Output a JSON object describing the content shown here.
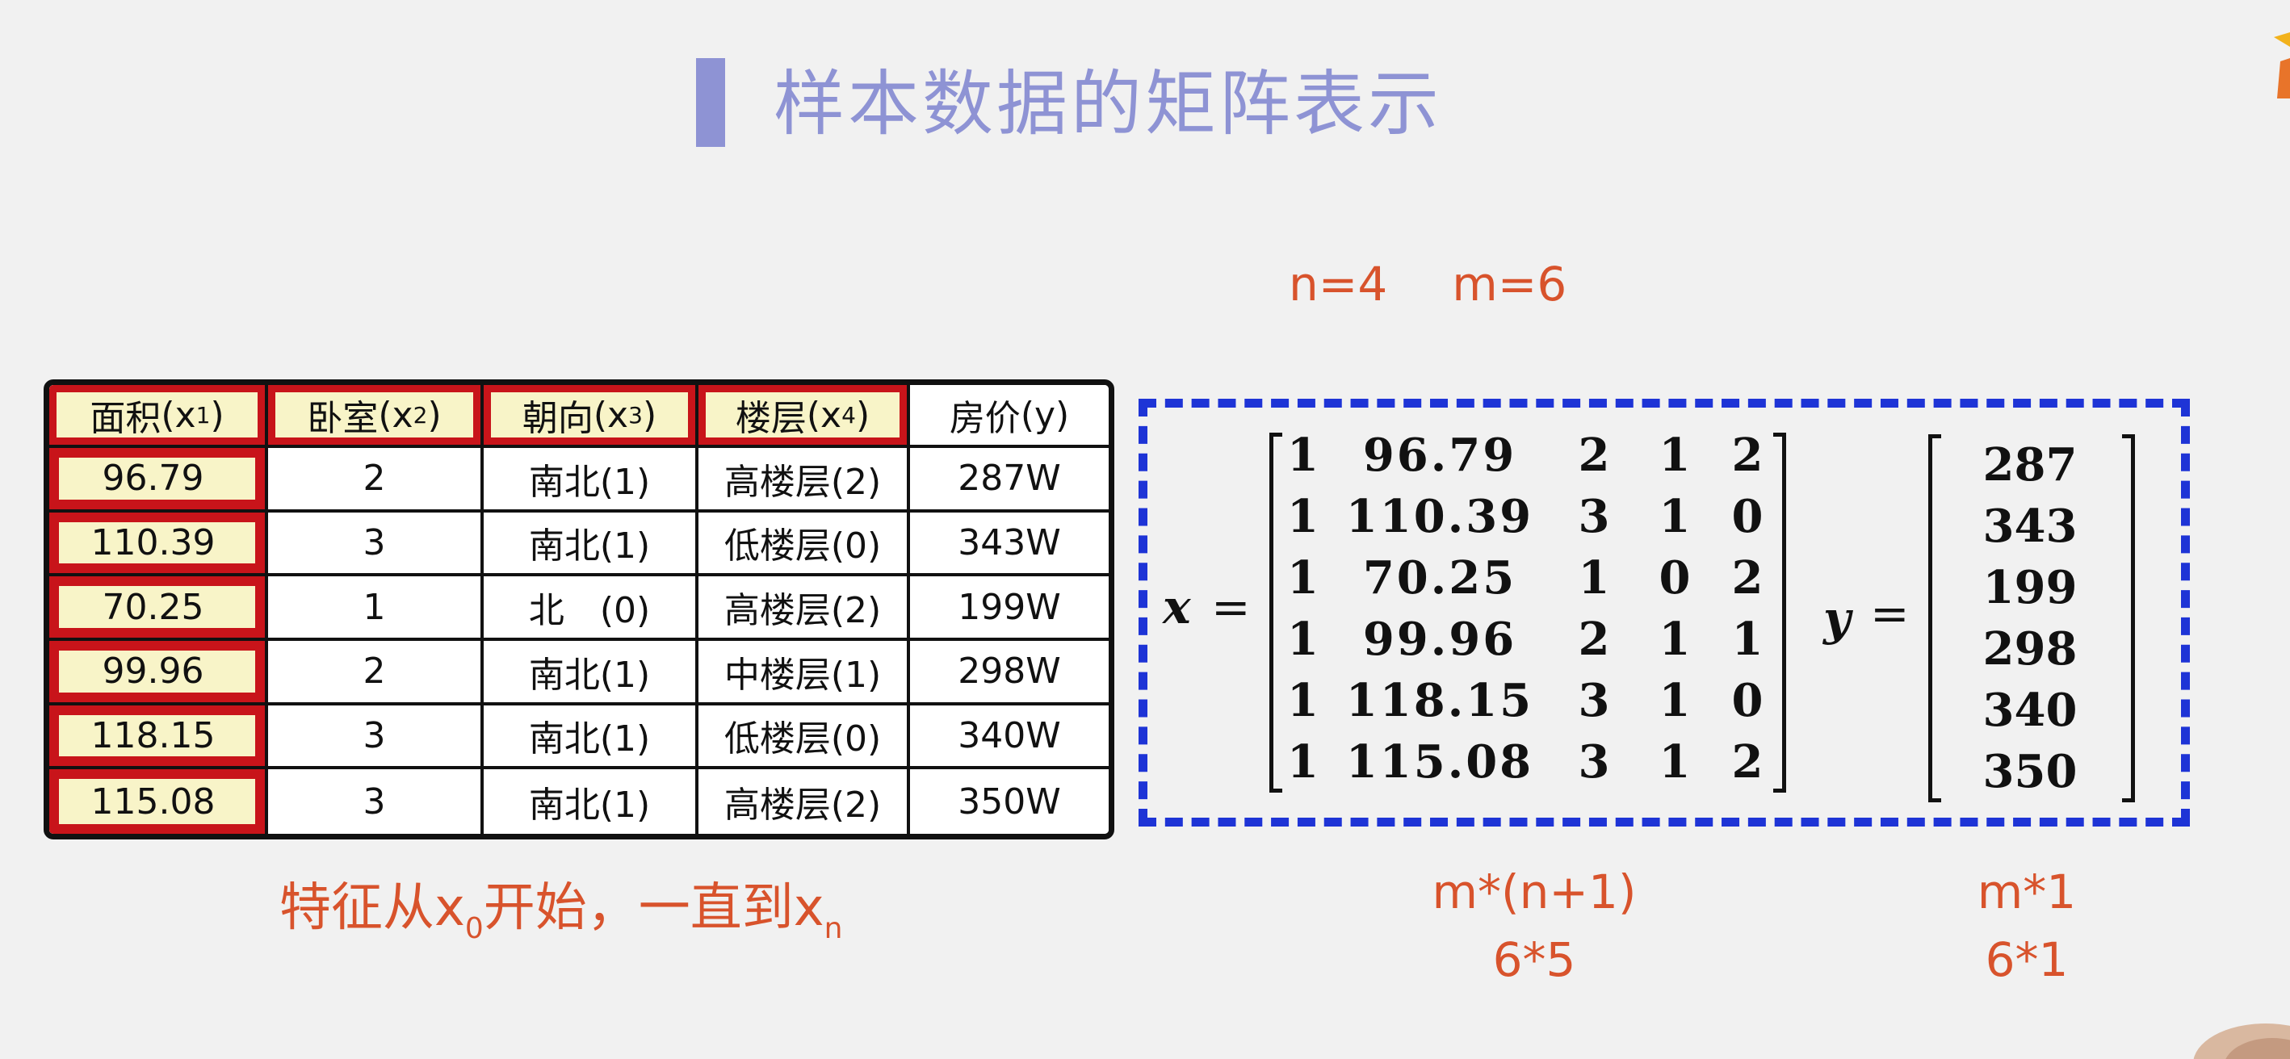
{
  "title": "样本数据的矩阵表示",
  "params": {
    "n": "n=4",
    "m": "m=6"
  },
  "table": {
    "headers": [
      {
        "label": "面积",
        "var": "(x",
        "sub": "1",
        "close": ")"
      },
      {
        "label": "卧室",
        "var": "(x",
        "sub": "2",
        "close": ")"
      },
      {
        "label": "朝向",
        "var": "(x",
        "sub": "3",
        "close": ")"
      },
      {
        "label": "楼层",
        "var": "(x",
        "sub": "4",
        "close": ")"
      },
      {
        "label": "房价",
        "var": "(y)",
        "sub": "",
        "close": ""
      }
    ],
    "rows": [
      [
        "96.79",
        "2",
        "南北(1)",
        "高楼层(2)",
        "287W"
      ],
      [
        "110.39",
        "3",
        "南北(1)",
        "低楼层(0)",
        "343W"
      ],
      [
        "70.25",
        "1",
        "北　(0)",
        "高楼层(2)",
        "199W"
      ],
      [
        "99.96",
        "2",
        "南北(1)",
        "中楼层(1)",
        "298W"
      ],
      [
        "118.15",
        "3",
        "南北(1)",
        "低楼层(0)",
        "340W"
      ],
      [
        "115.08",
        "3",
        "南北(1)",
        "高楼层(2)",
        "350W"
      ]
    ]
  },
  "note": {
    "prefix": "特征从x",
    "sub0": "0",
    "middle": "开始，一直到x",
    "subn": "n"
  },
  "matrix_x": {
    "label": "x",
    "equals": "=",
    "rows": [
      [
        "1",
        "96.79",
        "2",
        "1",
        "2"
      ],
      [
        "1",
        "110.39",
        "3",
        "1",
        "0"
      ],
      [
        "1",
        "70.25",
        "1",
        "0",
        "2"
      ],
      [
        "1",
        "99.96",
        "2",
        "1",
        "1"
      ],
      [
        "1",
        "118.15",
        "3",
        "1",
        "0"
      ],
      [
        "1",
        "115.08",
        "3",
        "1",
        "2"
      ]
    ],
    "dim_formula": "m*(n+1)",
    "dim_value": "6*5"
  },
  "matrix_y": {
    "label": "y",
    "equals": "=",
    "values": [
      "287",
      "343",
      "199",
      "298",
      "340",
      "350"
    ],
    "dim_formula": "m*1",
    "dim_value": "6*1"
  },
  "colors": {
    "title": "#8e93d4",
    "accent_orange": "#d8532c",
    "highlight_red": "#c8141a",
    "highlight_fill": "#f8f4c8",
    "dashed_box": "#1e34d6"
  }
}
